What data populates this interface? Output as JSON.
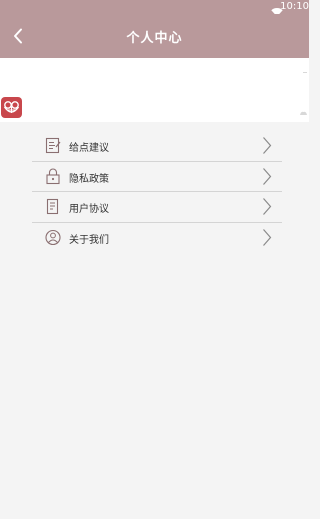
{
  "status_bar": {
    "time": "10:10",
    "wifi_icon": "wifi-icon"
  },
  "header": {
    "title": "个人中心",
    "back_icon": "back-arrow-icon"
  },
  "profile": {
    "avatar_icon": "app-logo-icon"
  },
  "menu": {
    "items": [
      {
        "label": "给点建议",
        "icon": "feedback-icon"
      },
      {
        "label": "隐私政策",
        "icon": "lock-icon"
      },
      {
        "label": "用户协议",
        "icon": "document-icon"
      },
      {
        "label": "关于我们",
        "icon": "user-icon"
      }
    ]
  },
  "colors": {
    "header_bg": "#b9999b",
    "page_bg": "#f4f4f4",
    "icon_stroke": "#8a6f71",
    "chevron": "#8a8a8a",
    "avatar_bg": "#c8474c"
  }
}
